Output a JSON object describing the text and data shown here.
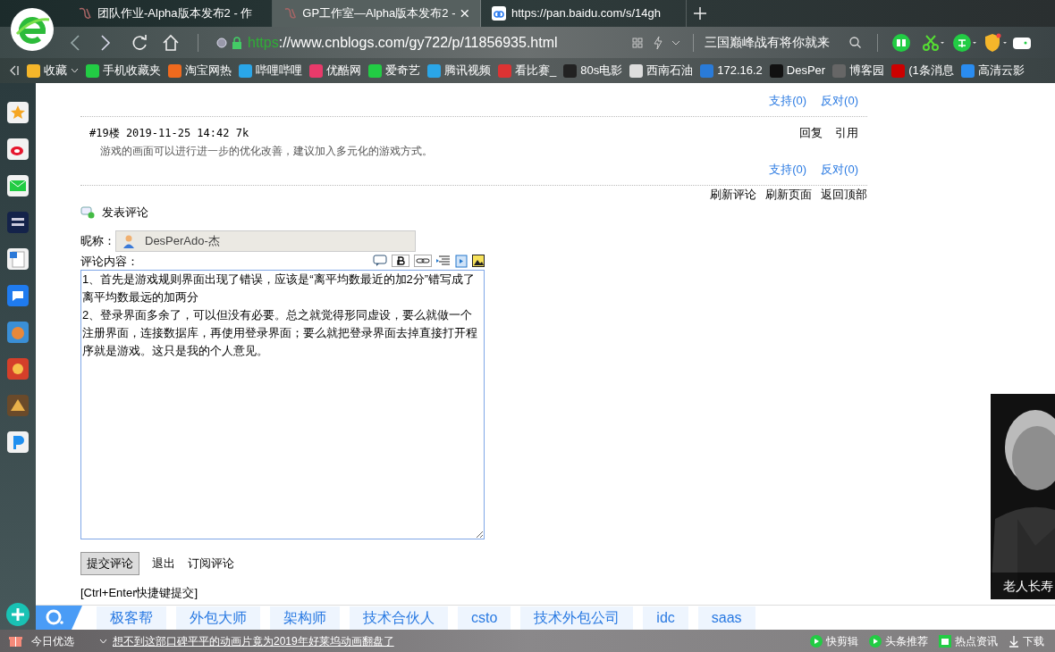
{
  "tabs": [
    {
      "title": "团队作业-Alpha版本发布2 - 作",
      "selected": false
    },
    {
      "title": "GP工作室—Alpha版本发布2 -",
      "selected": true
    },
    {
      "title": "https://pan.baidu.com/s/14gh",
      "selected": false
    }
  ],
  "address": {
    "scheme": "https",
    "rest": "://www.cnblogs.com/gy722/p/11856935.html"
  },
  "search": {
    "placeholder": "三国巅峰战有将你就来"
  },
  "bookmarks": [
    "收藏",
    "手机收藏夹",
    "淘宝网热",
    "哔哩哔哩",
    "优酷网",
    "爱奇艺",
    "腾讯视频",
    "看比赛_",
    "80s电影",
    "西南石油",
    "172.16.2",
    "DesPer",
    "博客园",
    "(1条消息",
    "高清云影"
  ],
  "previous_votes": [
    "支持(0)",
    "反对(0)"
  ],
  "comment": {
    "header": "#19楼 2019-11-25 14:42 7k",
    "body": "游戏的画面可以进行进一步的优化改善，建议加入多元化的游戏方式。",
    "actions": [
      "回复",
      "引用"
    ],
    "votes": [
      "支持(0)",
      "反对(0)"
    ]
  },
  "page_links": [
    "刷新评论",
    "刷新页面",
    "返回顶部"
  ],
  "comment_form": {
    "title": "发表评论",
    "nickname_label": "昵称：",
    "nickname": "DesPerAdo-杰",
    "content_label": "评论内容：",
    "content": "1、首先是游戏规则界面出现了错误，应该是“离平均数最近的加2分”错写成了离平均数最远的加两分\n2、登录界面多余了，可以但没有必要。总之就觉得形同虚设，要么就做一个注册界面，连接数据库，再使用登录界面；要么就把登录界面去掉直接打开程序就是游戏。这只是我的个人意见。",
    "submit": "提交评论",
    "links": [
      "退出",
      "订阅评论"
    ],
    "hint": "[Ctrl+Enter快捷键提交]"
  },
  "tag_bar": [
    "极客帮",
    "外包大师",
    "架构师",
    "技术合伙人",
    "csto",
    "技术外包公司",
    "idc",
    "saas"
  ],
  "ad": {
    "caption": "老人长寿"
  },
  "status_bar": {
    "label": "今日优选",
    "headline": "想不到这部口碑平平的动画片竟为2019年好莱坞动画翻盘了",
    "items": [
      "快剪辑",
      "头条推荐",
      "热点资讯",
      "下载"
    ]
  }
}
